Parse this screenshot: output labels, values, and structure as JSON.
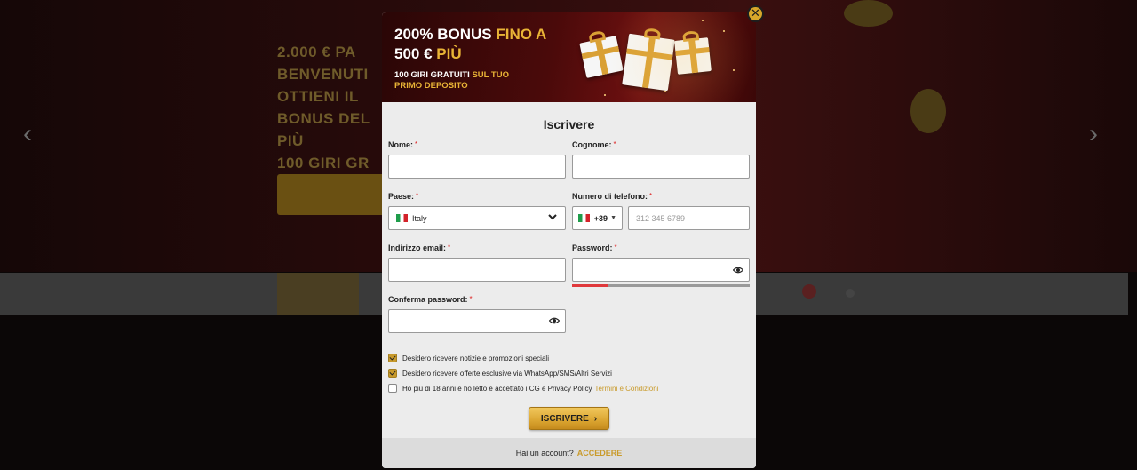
{
  "background": {
    "hero_lines": [
      "2.000 € PA",
      "BENVENUTI",
      "OTTIENI IL",
      "BONUS DEL",
      "PIÙ",
      "100 GIRI GR"
    ],
    "nav_prev_glyph": "‹",
    "nav_next_glyph": "›"
  },
  "modal": {
    "close_glyph": "✕",
    "banner": {
      "title_part1": "200% BONUS",
      "title_part2": "FINO A",
      "title_part3": "500 €",
      "title_part4": "PIÙ",
      "sub_part1": "100 GIRI GRATUITI",
      "sub_part2": "SUL TUO",
      "sub_part3": "PRIMO DEPOSITO"
    },
    "title": "Iscrivere",
    "fields": {
      "first_name": {
        "label": "Nome:",
        "value": ""
      },
      "last_name": {
        "label": "Cognome:",
        "value": ""
      },
      "country": {
        "label": "Paese:",
        "value": "Italy"
      },
      "phone": {
        "label": "Numero di telefono:",
        "code": "+39",
        "placeholder": "312 345 6789",
        "value": ""
      },
      "email": {
        "label": "Indirizzo email:",
        "value": ""
      },
      "password": {
        "label": "Password:",
        "value": "",
        "strength": 0.2
      },
      "confirm_password": {
        "label": "Conferma password:",
        "value": ""
      }
    },
    "required_mark": "*",
    "checkboxes": [
      {
        "label": "Desidero ricevere notizie e promozioni speciali",
        "checked": true
      },
      {
        "label": "Desidero ricevere offerte esclusive via WhatsApp/SMS/Altri Servizi",
        "checked": true
      },
      {
        "label": "Ho più di 18 anni e ho letto e accettato i CG e Privacy Policy",
        "link": "Termini e Condizioni",
        "checked": false
      }
    ],
    "submit_label": "ISCRIVERE",
    "submit_arrow": "›",
    "footer": {
      "text": "Hai un account?",
      "link": "ACCEDERE"
    }
  },
  "colors": {
    "accent": "#e9b436",
    "required": "#dd2222",
    "strength_weak": "#e0393c"
  }
}
